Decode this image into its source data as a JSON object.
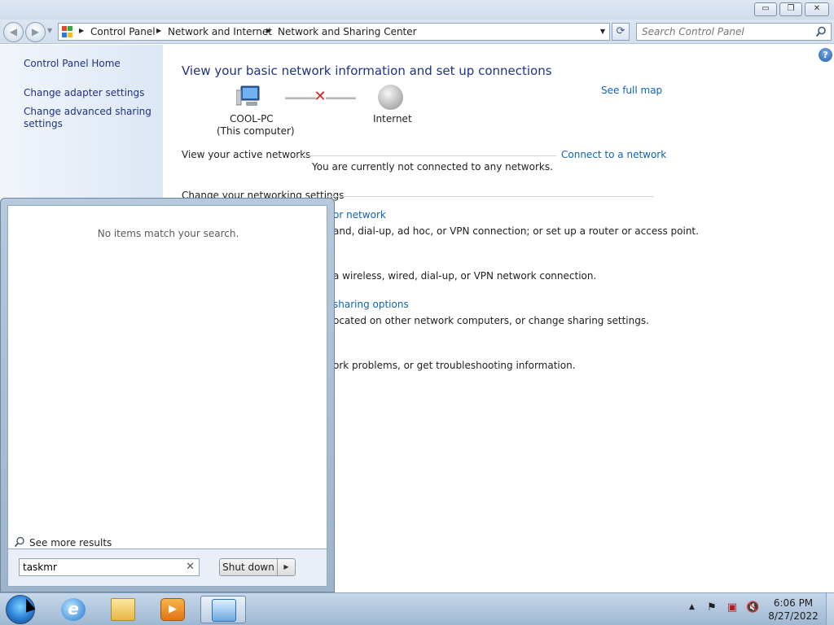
{
  "window": {
    "minimize_glyph": "▭",
    "maximize_glyph": "❐",
    "close_glyph": "✕"
  },
  "address_bar": {
    "breadcrumbs": [
      "Control Panel",
      "Network and Internet",
      "Network and Sharing Center"
    ],
    "search_placeholder": "Search Control Panel"
  },
  "left_pane": {
    "links": [
      "Control Panel Home",
      "Change adapter settings",
      "Change advanced sharing",
      "settings"
    ]
  },
  "main": {
    "title": "View your basic network information and set up connections",
    "see_full_map": "See full map",
    "computer_name": "COOL-PC",
    "computer_sub": "(This computer)",
    "internet_label": "Internet",
    "active_networks_label": "View your active networks",
    "connect_link": "Connect to a network",
    "not_connected": "You are currently not connected to any networks.",
    "change_settings_heading": "Change your networking settings",
    "tasks": [
      {
        "link_fragment": "or network",
        "desc_fragment": "and, dial-up, ad hoc, or VPN connection; or set up a router or access point."
      },
      {
        "desc_fragment": "a wireless, wired, dial-up, or VPN network connection."
      },
      {
        "link_fragment": "sharing options",
        "desc_fragment": "ocated on other network computers, or change sharing settings."
      },
      {
        "desc_fragment": "ork problems, or get troubleshooting information."
      }
    ]
  },
  "start_menu": {
    "no_items": "No items match your search.",
    "see_more": "See more results",
    "search_value": "taskmr",
    "shutdown_label": "Shut down"
  },
  "taskbar": {
    "clock_time": "6:06 PM",
    "clock_date": "8/27/2022"
  },
  "colors": {
    "link": "#0e63b5",
    "title": "#1e3287"
  }
}
